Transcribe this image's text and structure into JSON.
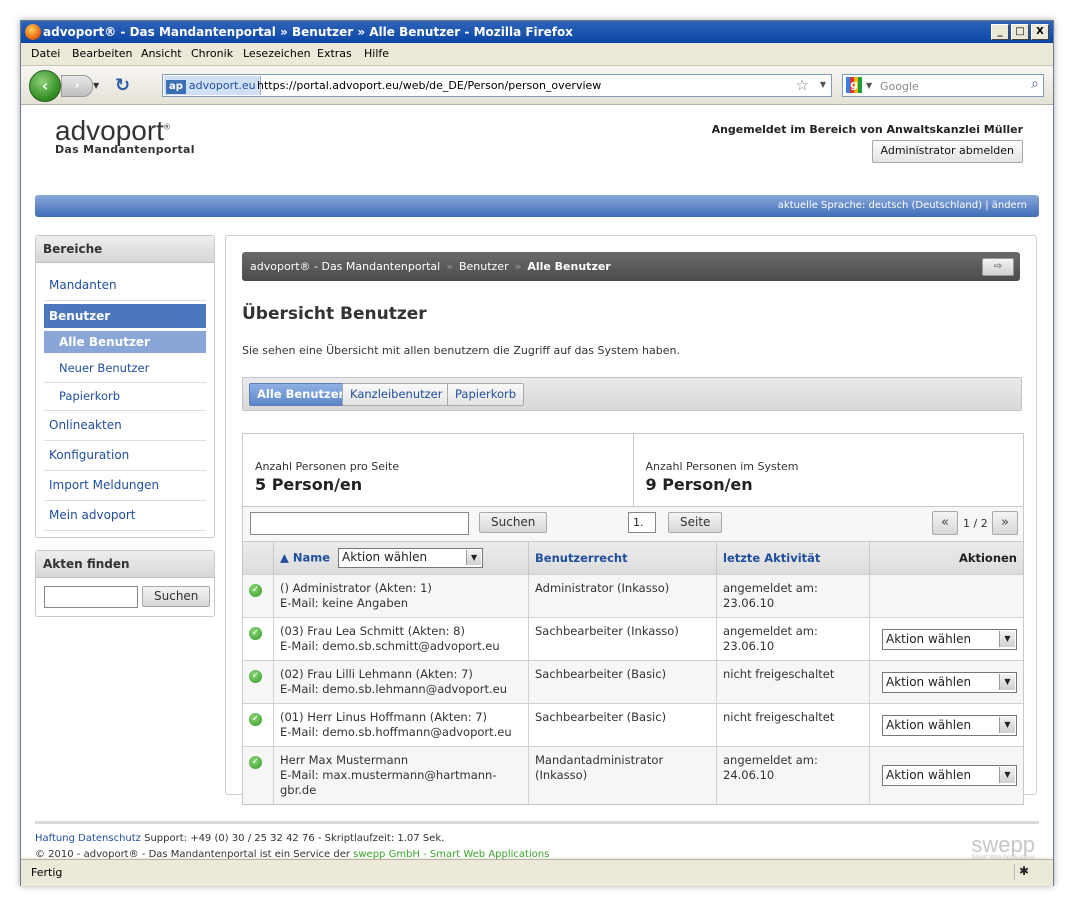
{
  "window": {
    "title": "advoport® - Das Mandantenportal » Benutzer » Alle Benutzer - Mozilla Firefox",
    "buttons": [
      "_",
      "□",
      "X"
    ]
  },
  "menu": [
    "Datei",
    "Bearbeiten",
    "Ansicht",
    "Chronik",
    "Lesezeichen",
    "Extras",
    "Hilfe"
  ],
  "nav": {
    "site_id": "advoport.eu",
    "site_badge": "ap",
    "url": "https://portal.advoport.eu/web/de_DE/Person/person_overview",
    "search_placeholder": "Google"
  },
  "header": {
    "logo_main": "advoport",
    "logo_sub": "Das Mandantenportal",
    "logged_in": "Angemeldet im Bereich von Anwaltskanzlei Müller",
    "logout_label": "Administrator abmelden",
    "language": "aktuelle Sprache: deutsch (Deutschland) | ändern"
  },
  "sidebar": {
    "heading": "Bereiche",
    "items": [
      {
        "label": "Mandanten",
        "kind": "item"
      },
      {
        "label": "Benutzer",
        "kind": "active"
      },
      {
        "label": "Alle Benutzer",
        "kind": "subactive"
      },
      {
        "label": "Neuer Benutzer",
        "kind": "sub"
      },
      {
        "label": "Papierkorb",
        "kind": "sub"
      },
      {
        "label": "Onlineakten",
        "kind": "item"
      },
      {
        "label": "Konfiguration",
        "kind": "item"
      },
      {
        "label": "Import Meldungen",
        "kind": "item"
      },
      {
        "label": "Mein advoport",
        "kind": "item"
      }
    ],
    "finder_heading": "Akten finden",
    "finder_button": "Suchen"
  },
  "breadcrumb": {
    "items": [
      "advoport® - Das Mandantenportal",
      "Benutzer",
      "Alle Benutzer"
    ],
    "sep": "»"
  },
  "page": {
    "title": "Übersicht Benutzer",
    "description": "Sie sehen eine Übersicht mit allen benutzern die Zugriff auf das System haben.",
    "tabs": [
      "Alle Benutzer",
      "Kanzleibenutzer",
      "Papierkorb"
    ]
  },
  "stats": {
    "per_page_label": "Anzahl Personen pro Seite",
    "per_page_value": "5 Person/en",
    "total_label": "Anzahl Personen im System",
    "total_value": "9 Person/en"
  },
  "pager": {
    "search_button": "Suchen",
    "page_input": "1.",
    "page_button": "Seite",
    "prev": "«",
    "info": "1 / 2",
    "next": "»"
  },
  "table": {
    "headers": {
      "name": "▲ Name",
      "name_select": "Aktion wählen",
      "rights": "Benutzerrecht",
      "activity": "letzte Aktivität",
      "actions": "Aktionen"
    },
    "rows": [
      {
        "name": "() Administrator (Akten: 1)",
        "email": "E-Mail: keine Angaben",
        "rights": "Administrator (Inkasso)",
        "activity": "angemeldet am:",
        "date": "23.06.10",
        "action": ""
      },
      {
        "name": "(03) Frau Lea Schmitt (Akten: 8)",
        "email": "E-Mail: demo.sb.schmitt@advoport.eu",
        "rights": "Sachbearbeiter (Inkasso)",
        "activity": "angemeldet am:",
        "date": "23.06.10",
        "action": "Aktion wählen"
      },
      {
        "name": "(02) Frau Lilli Lehmann (Akten: 7)",
        "email": "E-Mail: demo.sb.lehmann@advoport.eu",
        "rights": "Sachbearbeiter (Basic)",
        "activity": "nicht freigeschaltet",
        "date": "",
        "action": "Aktion wählen"
      },
      {
        "name": "(01) Herr Linus Hoffmann (Akten: 7)",
        "email": "E-Mail: demo.sb.hoffmann@advoport.eu",
        "rights": "Sachbearbeiter (Basic)",
        "activity": "nicht freigeschaltet",
        "date": "",
        "action": "Aktion wählen"
      },
      {
        "name": "Herr Max Mustermann",
        "email": "E-Mail: max.mustermann@hartmann-gbr.de",
        "rights": "Mandantadministrator (Inkasso)",
        "activity": "angemeldet am:",
        "date": "24.06.10",
        "action": "Aktion wählen"
      }
    ]
  },
  "footer": {
    "link1": "Haftung",
    "link2": "Datenschutz",
    "support": "Support: +49 (0) 30 / 25 32 42 76 - Skriptlaufzeit: 1.07 Sek.",
    "copyright": "© 2010 - advoport® - Das Mandantenportal ist ein Service der",
    "company": "swepp GmbH - Smart Web Applications",
    "logo": "swepp",
    "logo_sub": "Smart Web Applications"
  },
  "status": {
    "text": "Fertig"
  }
}
